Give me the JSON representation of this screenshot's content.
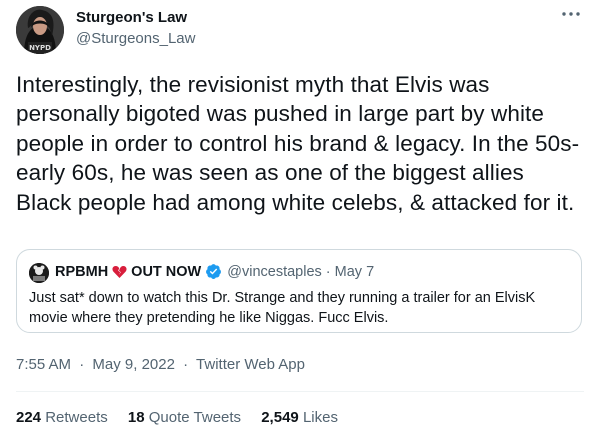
{
  "author": {
    "name": "Sturgeon's Law",
    "handle": "@Sturgeons_Law"
  },
  "more_icon": "more-horizontal-icon",
  "tweet_text": "Interestingly, the revisionist myth that Elvis was personally bigoted was pushed in large part by white people in order to control his brand & legacy. In the 50s-early 60s, he was seen as one of the biggest allies Black people had among white celebs, & attacked for it.",
  "quoted": {
    "name_part1": "RPBMH",
    "name_part2": "OUT NOW",
    "handle_date": "@vincestaples · May 7",
    "text": "Just sat* down to watch this Dr. Strange and they running a trailer for an ElvisK movie where they pretending he like Niggas. Fucc Elvis."
  },
  "meta": {
    "time": "7:55 AM",
    "date": "May 9, 2022",
    "source": "Twitter Web App",
    "separator": "·"
  },
  "stats": {
    "retweets_count": "224",
    "retweets_label": "Retweets",
    "quotes_count": "18",
    "quotes_label": "Quote Tweets",
    "likes_count": "2,549",
    "likes_label": "Likes"
  },
  "colors": {
    "text": "#0f1419",
    "secondary": "#536471",
    "border": "#cfd9de",
    "verified": "#1d9bf0",
    "broken_heart": "#d81e3c"
  }
}
